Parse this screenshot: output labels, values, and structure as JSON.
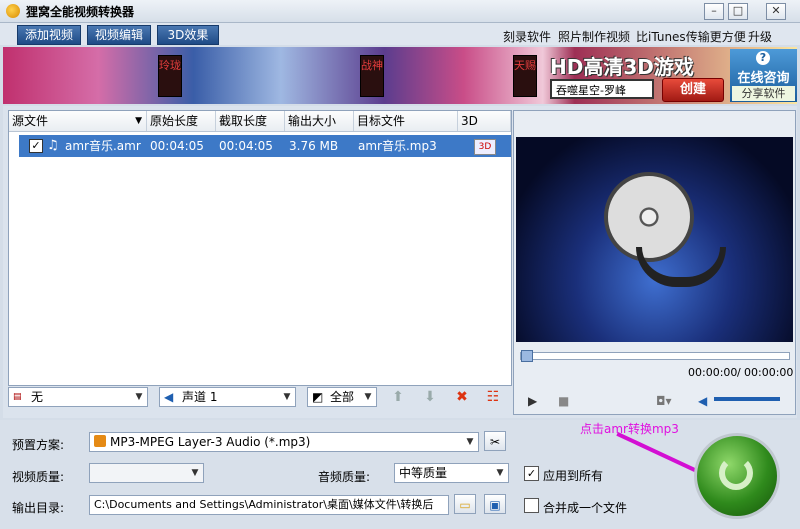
{
  "window": {
    "title": "狸窝全能视频转换器"
  },
  "toolbar": {
    "buttons": [
      "添加视频",
      "视频编辑",
      "3D效果"
    ],
    "links": [
      "刻录软件",
      "照片制作视频",
      "比iTunes传输更方便",
      "升级"
    ]
  },
  "banner": {
    "tags": [
      "玲珑",
      "战神",
      "天赐"
    ],
    "headline": "HD高清3D游戏",
    "search_text": "吞噬星空-罗峰",
    "create_label": "创建",
    "consult_label": "在线咨询",
    "share_label": "分享软件"
  },
  "filelist": {
    "columns": [
      "源文件",
      "原始长度",
      "截取长度",
      "输出大小",
      "目标文件",
      "3D"
    ],
    "rows": [
      {
        "source": "amr音乐.amr",
        "orig_length": "00:04:05",
        "cut_length": "00:04:05",
        "size": "3.76 MB",
        "target": "amr音乐.mp3"
      }
    ]
  },
  "listbar": {
    "subtitle": "无",
    "audio_track": "声道 1",
    "select": "全部"
  },
  "preview": {
    "time_left": "00:00:00",
    "time_right": "00:00:00"
  },
  "settings": {
    "preset_label": "预置方案:",
    "preset_value": "MP3-MPEG Layer-3 Audio (*.mp3)",
    "video_quality_label": "视频质量:",
    "video_quality_value": "",
    "audio_quality_label": "音频质量:",
    "audio_quality_value": "中等质量",
    "apply_all_label": "应用到所有",
    "output_label": "输出目录:",
    "output_value": "C:\\Documents and Settings\\Administrator\\桌面\\媒体文件\\转换后",
    "merge_label": "合并成一个文件"
  },
  "annotation": {
    "hint": "点击amr转换mp3"
  }
}
